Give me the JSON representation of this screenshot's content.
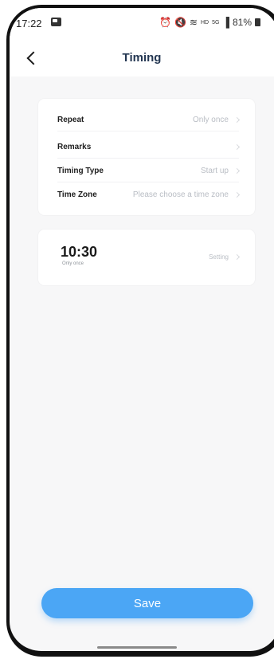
{
  "status_bar": {
    "time": "17:22",
    "network": "5G",
    "battery": "81%"
  },
  "nav": {
    "title": "Timing"
  },
  "settings": {
    "rows": [
      {
        "label": "Repeat",
        "value": "Only once"
      },
      {
        "label": "Remarks",
        "value": ""
      },
      {
        "label": "Timing Type",
        "value": "Start up"
      },
      {
        "label": "Time Zone",
        "value": "Please choose a time zone"
      }
    ]
  },
  "timer": {
    "time": "10:30",
    "repeat": "Only once",
    "setting_label": "Setting"
  },
  "footer": {
    "save_label": "Save"
  },
  "colors": {
    "accent": "#4ba6f5",
    "title": "#243752",
    "muted": "#b9bdc4"
  }
}
